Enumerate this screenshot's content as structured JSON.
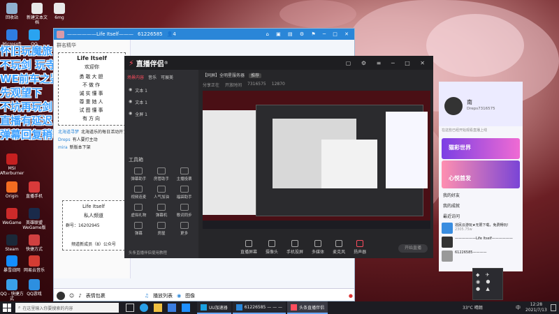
{
  "desktop": {
    "icons": [
      {
        "label": "回收站",
        "color": "#8fb0d0"
      },
      {
        "label": "新建文本文档",
        "color": "#e8e8e8"
      },
      {
        "label": "6mg",
        "color": "#e8e8e8"
      },
      {
        "label": "Microsoft",
        "color": "#2f7de0"
      },
      {
        "label": "QQ",
        "color": "#2aa3f0"
      },
      {
        "label": "MSI Afterburner",
        "color": "#c52020"
      },
      {
        "label": "Origin",
        "color": "#f36c21"
      },
      {
        "label": "直播手机",
        "color": "#d83a3a"
      },
      {
        "label": "WeGame",
        "color": "#cc2a2a"
      },
      {
        "label": "英雄联盟 WeGame版",
        "color": "#1a2a4a"
      },
      {
        "label": "Steam",
        "color": "#1b2838"
      },
      {
        "label": "快捷方式",
        "color": "#d04040"
      },
      {
        "label": "暴雪战网",
        "color": "#148eff"
      },
      {
        "label": "网易云音乐",
        "color": "#d43c33"
      },
      {
        "label": "QQ - 快捷方式",
        "color": "#3aa0e8"
      },
      {
        "label": "QQ游戏",
        "color": "#2d8fe0"
      }
    ]
  },
  "overlay_lines": [
    "怀旧玩魔旅",
    "不玩剑 玩寺",
    "WE前车之鉴",
    "先观望下",
    "不坑再玩剑",
    "直播有延迟",
    "弹幕回复稍等"
  ],
  "qq_group": {
    "title": "——————Life Itself——————",
    "group_id": "61226585",
    "member_count": "4",
    "tab": "群名精华",
    "card_title": "Life Itself",
    "card_welcome": "欢迎你",
    "lines": [
      "勇敢大胆",
      "不做作",
      "诚实懂事",
      "尊重她人",
      "试图懂事",
      "有方向"
    ],
    "chat_items": [
      {
        "user": "北海道寻梦",
        "text": "北海道乐的每日活动开了"
      },
      {
        "user": "Dreps",
        "text": "有人要打主动"
      },
      {
        "user": "mira",
        "text": "新版本下架"
      }
    ],
    "card2_title": "Life Itself",
    "card2_sub": "私人频道",
    "card2_id": "群号：16202945",
    "footer": "频道新成员（8）公众号",
    "inputbar_text": "表情包裹",
    "inputbar_file": "播放列表",
    "inputbar_tag": "图像"
  },
  "obs": {
    "brand": "直播伴侣",
    "brand_sup": "®",
    "tabs": [
      "场景内容",
      "音乐",
      "可展美"
    ],
    "scene_title": "【同屏】全明星服务器",
    "scene_badge": "推荐",
    "stream_meta": [
      "分享正在",
      "开放时间",
      "7316575",
      "12870"
    ],
    "sources": [
      "文本 1",
      "文本 1",
      "全屏 1"
    ],
    "tools_title": "工具箱",
    "tools": [
      "弹幕助手",
      "房管助手",
      "主播投票",
      "视频连麦",
      "人气加油",
      "福袋助手",
      "虚拟礼物",
      "弹幕机",
      "歌词同步",
      "弹幕",
      "房屋",
      "更多"
    ],
    "bottom_actions": [
      "直播屏幕",
      "摄像头",
      "手机投屏",
      "多媒体",
      "麦克风",
      "扬声器"
    ],
    "go_live": "开始直播",
    "footer_notice": "头条直播伴侣使用教程"
  },
  "profile": {
    "name": "南",
    "user_id": "Dreps7316575",
    "hint": "在这些已经开始观看直播上线",
    "banner1": "猫彩世界",
    "banner2": "心悦首发",
    "sec_friends": "我的好友",
    "sec_mine": "我的成就",
    "sec_recent": "最近访问",
    "item1_title": "逃民云游玩★无限下载，免费畅玩!",
    "item1_sub": "2305.75w",
    "item2_title": "——————Life Itself——————",
    "item3_title": "61226585————",
    "tray_time": "12:28",
    "tray_date": "2021/7/13"
  },
  "taskbar": {
    "search_placeholder": "在这里输入你要搜索的内容",
    "tasks": [
      "UU加速器",
      "61226585 — — —",
      "头条直播伴侣"
    ],
    "weather": "33°C 晴朗",
    "time": "12:28",
    "date": "2021/7/13",
    "lang": "中"
  },
  "colors": {
    "obs_bg": "#262629",
    "obs_panel": "#2e2e32",
    "accent_red": "#ff4d5e",
    "qq_blue": "#2a86d8",
    "taskbar": "#1c1c22"
  }
}
